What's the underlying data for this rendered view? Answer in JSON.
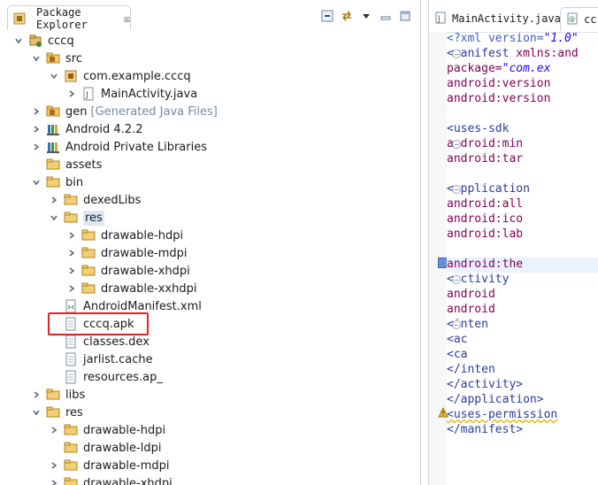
{
  "explorer": {
    "title": "Package Explorer",
    "close_glyph": "☒"
  },
  "tree": [
    {
      "label": "cccq",
      "indent": 0,
      "expanded": true,
      "icon": "project-icon"
    },
    {
      "label": "src",
      "indent": 1,
      "expanded": true,
      "icon": "source-folder-icon"
    },
    {
      "label": "com.example.cccq",
      "indent": 2,
      "expanded": true,
      "icon": "package-icon"
    },
    {
      "label": "MainActivity.java",
      "indent": 3,
      "expanded": false,
      "icon": "java-file-icon"
    },
    {
      "label": "gen",
      "suffix": "[Generated Java Files]",
      "indent": 1,
      "expanded": false,
      "icon": "source-folder-icon"
    },
    {
      "label": "Android 4.2.2",
      "indent": 1,
      "expanded": false,
      "icon": "library-icon"
    },
    {
      "label": "Android Private Libraries",
      "indent": 1,
      "expanded": false,
      "icon": "library-icon"
    },
    {
      "label": "assets",
      "indent": 1,
      "expanded": null,
      "icon": "folder-icon"
    },
    {
      "label": "bin",
      "indent": 1,
      "expanded": true,
      "icon": "folder-icon"
    },
    {
      "label": "dexedLibs",
      "indent": 2,
      "expanded": false,
      "icon": "folder-icon"
    },
    {
      "label": "res",
      "indent": 2,
      "expanded": true,
      "icon": "folder-icon",
      "selected": true
    },
    {
      "label": "drawable-hdpi",
      "indent": 3,
      "expanded": false,
      "icon": "folder-icon"
    },
    {
      "label": "drawable-mdpi",
      "indent": 3,
      "expanded": false,
      "icon": "folder-icon"
    },
    {
      "label": "drawable-xhdpi",
      "indent": 3,
      "expanded": false,
      "icon": "folder-icon"
    },
    {
      "label": "drawable-xxhdpi",
      "indent": 3,
      "expanded": false,
      "icon": "folder-icon"
    },
    {
      "label": "AndroidManifest.xml",
      "indent": 2,
      "expanded": null,
      "icon": "xml-file-icon"
    },
    {
      "label": "cccq.apk",
      "indent": 2,
      "expanded": null,
      "icon": "file-icon"
    },
    {
      "label": "classes.dex",
      "indent": 2,
      "expanded": null,
      "icon": "file-icon"
    },
    {
      "label": "jarlist.cache",
      "indent": 2,
      "expanded": null,
      "icon": "file-icon"
    },
    {
      "label": "resources.ap_",
      "indent": 2,
      "expanded": null,
      "icon": "file-icon"
    },
    {
      "label": "libs",
      "indent": 1,
      "expanded": false,
      "icon": "folder-icon"
    },
    {
      "label": "res",
      "indent": 1,
      "expanded": true,
      "icon": "folder-icon"
    },
    {
      "label": "drawable-hdpi",
      "indent": 2,
      "expanded": false,
      "icon": "folder-icon"
    },
    {
      "label": "drawable-ldpi",
      "indent": 2,
      "expanded": null,
      "icon": "folder-icon"
    },
    {
      "label": "drawable-mdpi",
      "indent": 2,
      "expanded": false,
      "icon": "folder-icon"
    },
    {
      "label": "drawable-xhdpi",
      "indent": 2,
      "expanded": false,
      "icon": "folder-icon"
    }
  ],
  "editor": {
    "tabs": [
      {
        "label": "MainActivity.java",
        "active": false
      },
      {
        "label": "cc",
        "active": true
      }
    ],
    "lines": [
      [
        {
          "t": "pi",
          "s": "<?xml version="
        },
        {
          "t": "val",
          "s": "\"1.0\""
        }
      ],
      [
        {
          "t": "tag",
          "s": "<manifest "
        },
        {
          "t": "attr",
          "s": "xmlns:and"
        }
      ],
      [
        {
          "t": "attr",
          "s": "    package="
        },
        {
          "t": "val",
          "s": "\"com.ex"
        }
      ],
      [
        {
          "t": "attr",
          "s": "    android:version"
        }
      ],
      [
        {
          "t": "attr",
          "s": "    android:version"
        }
      ],
      [
        {
          "t": "txt",
          "s": ""
        }
      ],
      [
        {
          "t": "tag",
          "s": "    <uses-sdk"
        }
      ],
      [
        {
          "t": "attr",
          "s": "        android:min"
        }
      ],
      [
        {
          "t": "attr",
          "s": "        android:tar"
        }
      ],
      [
        {
          "t": "txt",
          "s": ""
        }
      ],
      [
        {
          "t": "tag",
          "s": "    <application"
        }
      ],
      [
        {
          "t": "attr",
          "s": "        android:all"
        }
      ],
      [
        {
          "t": "attr",
          "s": "        android:ico"
        }
      ],
      [
        {
          "t": "attr",
          "s": "        android:lab"
        }
      ],
      [
        {
          "t": "txt",
          "s": ""
        }
      ],
      [
        {
          "t": "attr",
          "s": "        android:the"
        }
      ],
      [
        {
          "t": "tag",
          "s": "        <activity"
        }
      ],
      [
        {
          "t": "attr",
          "s": "            android"
        }
      ],
      [
        {
          "t": "attr",
          "s": "            android"
        }
      ],
      [
        {
          "t": "tag",
          "s": "            <inten"
        }
      ],
      [
        {
          "t": "tag",
          "s": "                <ac"
        }
      ],
      [
        {
          "t": "tag",
          "s": "                <ca"
        }
      ],
      [
        {
          "t": "tag",
          "s": "            </inten"
        }
      ],
      [
        {
          "t": "tag",
          "s": "        </activity>"
        }
      ],
      [
        {
          "t": "tag",
          "s": "    </application>"
        }
      ],
      [
        {
          "t": "tag",
          "s": "   <uses-permission"
        }
      ],
      [
        {
          "t": "tag",
          "s": "</manifest>"
        }
      ]
    ]
  }
}
